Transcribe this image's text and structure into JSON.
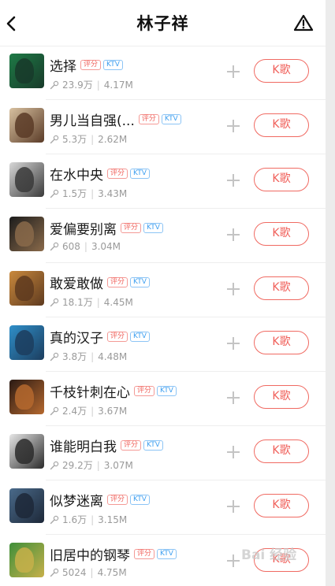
{
  "header": {
    "title": "林子祥"
  },
  "songs": [
    {
      "title": "选择",
      "tags": [
        "评分",
        "KTV"
      ],
      "plays": "23.9万",
      "size": "4.17M",
      "button": "K歌",
      "cover_colors": [
        "#1e7a46",
        "#183a2a"
      ]
    },
    {
      "title": "男儿当自强(...",
      "tags": [
        "评分",
        "KTV"
      ],
      "plays": "5.3万",
      "size": "2.62M",
      "button": "K歌",
      "cover_colors": [
        "#d8c1a0",
        "#5a3b27"
      ]
    },
    {
      "title": "在水中央",
      "tags": [
        "评分",
        "KTV"
      ],
      "plays": "1.5万",
      "size": "3.43M",
      "button": "K歌",
      "cover_colors": [
        "#d7d7d7",
        "#3a3a3a"
      ]
    },
    {
      "title": "爱偏要别离",
      "tags": [
        "评分",
        "KTV"
      ],
      "plays": "608",
      "size": "3.04M",
      "button": "K歌",
      "cover_colors": [
        "#1c1c1c",
        "#8a6a4a"
      ]
    },
    {
      "title": "敢爱敢做",
      "tags": [
        "评分",
        "KTV"
      ],
      "plays": "18.1万",
      "size": "4.45M",
      "button": "K歌",
      "cover_colors": [
        "#c9893d",
        "#5e3a1f"
      ]
    },
    {
      "title": "真的汉子",
      "tags": [
        "评分",
        "KTV"
      ],
      "plays": "3.8万",
      "size": "4.48M",
      "button": "K歌",
      "cover_colors": [
        "#2f8fc9",
        "#1c3d5e"
      ]
    },
    {
      "title": "千枝针刺在心",
      "tags": [
        "评分",
        "KTV"
      ],
      "plays": "2.4万",
      "size": "3.67M",
      "button": "K歌",
      "cover_colors": [
        "#2a1a14",
        "#b5682e"
      ]
    },
    {
      "title": "谁能明白我",
      "tags": [
        "评分",
        "KTV"
      ],
      "plays": "29.2万",
      "size": "3.07M",
      "button": "K歌",
      "cover_colors": [
        "#e6e6e6",
        "#2b2b2b"
      ]
    },
    {
      "title": "似梦迷离",
      "tags": [
        "评分",
        "KTV"
      ],
      "plays": "1.6万",
      "size": "3.15M",
      "button": "K歌",
      "cover_colors": [
        "#4a6a8a",
        "#1d2838"
      ]
    },
    {
      "title": "旧居中的钢琴",
      "tags": [
        "评分",
        "KTV"
      ],
      "plays": "5024",
      "size": "4.75M",
      "button": "K歌",
      "cover_colors": [
        "#3f8f3a",
        "#c7b04a"
      ]
    }
  ],
  "watermark": "Bai 经验"
}
